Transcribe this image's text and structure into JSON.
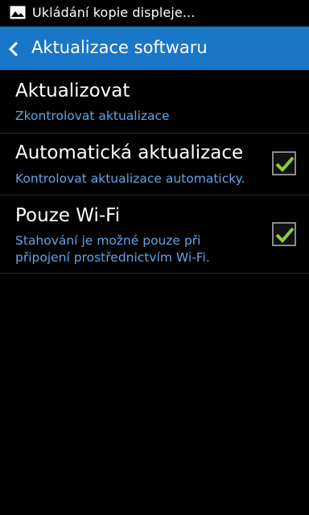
{
  "status_bar": {
    "notification_text": "Ukládání kopie displeje...",
    "notification_icon": "image-icon"
  },
  "action_bar": {
    "back_icon": "chevron-left-icon",
    "title": "Aktualizace softwaru",
    "background_color": "#1976c8"
  },
  "settings": [
    {
      "title": "Aktualizovat",
      "subtitle_lines": [
        "Zkontrolovat aktualizace"
      ],
      "has_checkbox": false
    },
    {
      "title": "Automatická aktualizace",
      "subtitle_lines": [
        "Kontrolovat aktualizace automaticky."
      ],
      "has_checkbox": true,
      "checked": true
    },
    {
      "title": "Pouze Wi-Fi",
      "subtitle_lines": [
        "Stahování je možné pouze při",
        "připojení prostřednictvím Wi-Fi."
      ],
      "has_checkbox": true,
      "checked": true
    }
  ],
  "colors": {
    "subtitle": "#5fa6e6",
    "check_mark": "#8cd23c"
  }
}
